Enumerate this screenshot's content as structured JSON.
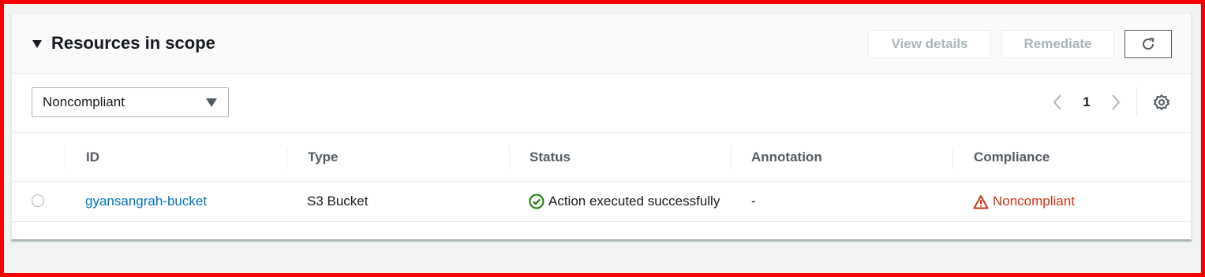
{
  "section": {
    "title": "Resources in scope",
    "buttons": {
      "view_details": "View details",
      "remediate": "Remediate",
      "refresh_icon": "refresh-icon"
    }
  },
  "filter": {
    "selected": "Noncompliant"
  },
  "pagination": {
    "current_page": "1"
  },
  "table": {
    "columns": [
      "ID",
      "Type",
      "Status",
      "Annotation",
      "Compliance"
    ],
    "rows": [
      {
        "id": "gyansangrah-bucket",
        "type": "S3 Bucket",
        "status": "Action executed successfully",
        "status_icon": "check-circle-icon",
        "annotation": "-",
        "compliance": "Noncompliant",
        "compliance_icon": "warning-icon"
      }
    ]
  },
  "colors": {
    "link": "#0073bb",
    "success": "#1d8102",
    "error": "#d13212",
    "frame": "#f50000"
  }
}
